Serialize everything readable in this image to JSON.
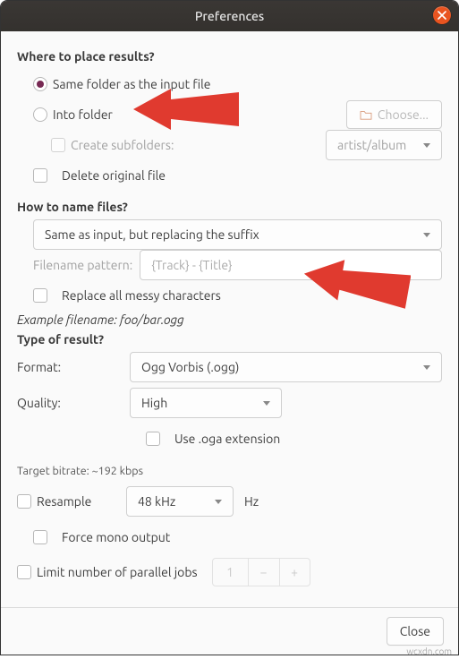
{
  "title": "Preferences",
  "sections": {
    "place": {
      "heading": "Where to place results?",
      "opt_same": "Same folder as the input file",
      "opt_into": "Into folder",
      "choose_btn": "Choose...",
      "create_sub": "Create subfolders:",
      "subfolder_select": "artist/album",
      "delete_orig": "Delete original file"
    },
    "name": {
      "heading": "How to name files?",
      "mode_select": "Same as input, but replacing the suffix",
      "pattern_label": "Filename pattern:",
      "pattern_value": "{Track} - {Title}",
      "replace_messy": "Replace all messy characters",
      "example": "Example filename: foo/bar.ogg"
    },
    "type": {
      "heading": "Type of result?",
      "format_label": "Format:",
      "format_value": "Ogg Vorbis (.ogg)",
      "quality_label": "Quality:",
      "quality_value": "High",
      "use_oga": "Use .oga extension",
      "target_bitrate": "Target bitrate: ~192 kbps",
      "resample": "Resample",
      "resample_value": "48 kHz",
      "hz": "Hz",
      "force_mono": "Force mono output",
      "limit_jobs": "Limit number of parallel jobs",
      "jobs_value": "1"
    }
  },
  "footer": {
    "close": "Close"
  },
  "watermark": "wcxdn.com"
}
